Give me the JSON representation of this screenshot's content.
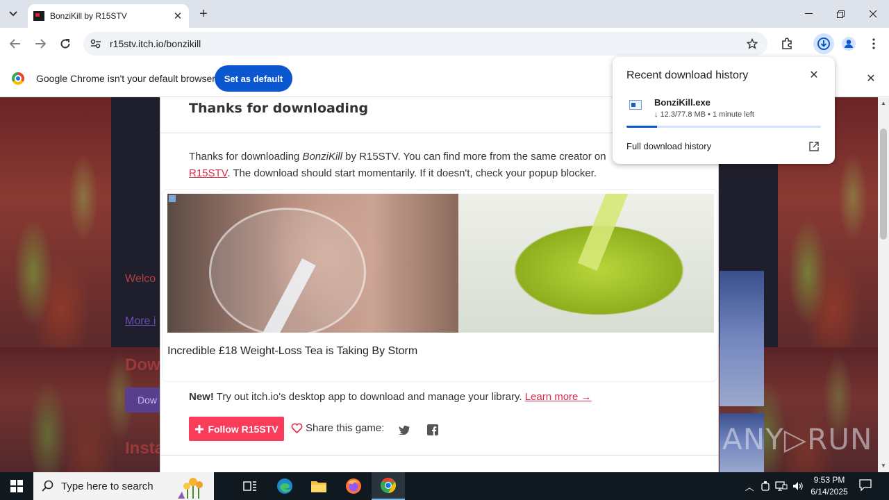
{
  "browser": {
    "tab_title": "BonziKill by R15STV",
    "url": "r15stv.itch.io/bonzikill"
  },
  "infobar": {
    "message": "Google Chrome isn't your default browser",
    "button": "Set as default"
  },
  "page": {
    "ghost_welcome": "Welco",
    "ghost_more": "More i",
    "ghost_download_head": "Dow",
    "ghost_download_btn": "Dow",
    "ghost_install_head": "Insta"
  },
  "modal": {
    "title": "Thanks for downloading",
    "text_prefix": "Thanks for downloading ",
    "game_name": "BonziKill",
    "text_by": " by R15STV. You can find more from the same creator on",
    "creator_link": "R15STV",
    "text_suffix": ". The download should start momentarily. If it doesn't, check your popup blocker.",
    "ad_caption": "Incredible £18 Weight-Loss Tea is Taking By Storm",
    "new_label": "New!",
    "new_text": " Try out itch.io's desktop app to download and manage your library. ",
    "learn_more": "Learn more →",
    "follow_button": "Follow R15STV",
    "share_label": "Share this game:"
  },
  "download_bubble": {
    "title": "Recent download history",
    "filename": "BonziKill.exe",
    "status": "↓ 12.3/77.8 MB • 1 minute left",
    "progress_fraction": 0.158,
    "full_history": "Full download history"
  },
  "watermark": "ANY▷RUN",
  "taskbar": {
    "search_placeholder": "Type here to search",
    "time": "9:53 PM",
    "date": "6/14/2025"
  },
  "icons": {
    "tab_search": "chevron-down-icon",
    "back": "back-arrow-icon",
    "forward": "forward-arrow-icon",
    "reload": "reload-icon",
    "site_info": "tune-icon",
    "bookmark": "star-icon",
    "extensions": "puzzle-icon",
    "download": "download-icon",
    "profile": "person-icon",
    "menu": "kebab-menu-icon"
  },
  "colors": {
    "chrome_blue": "#0b57d0",
    "itch_red": "#fa3c5b",
    "link_red": "#da2c49"
  }
}
